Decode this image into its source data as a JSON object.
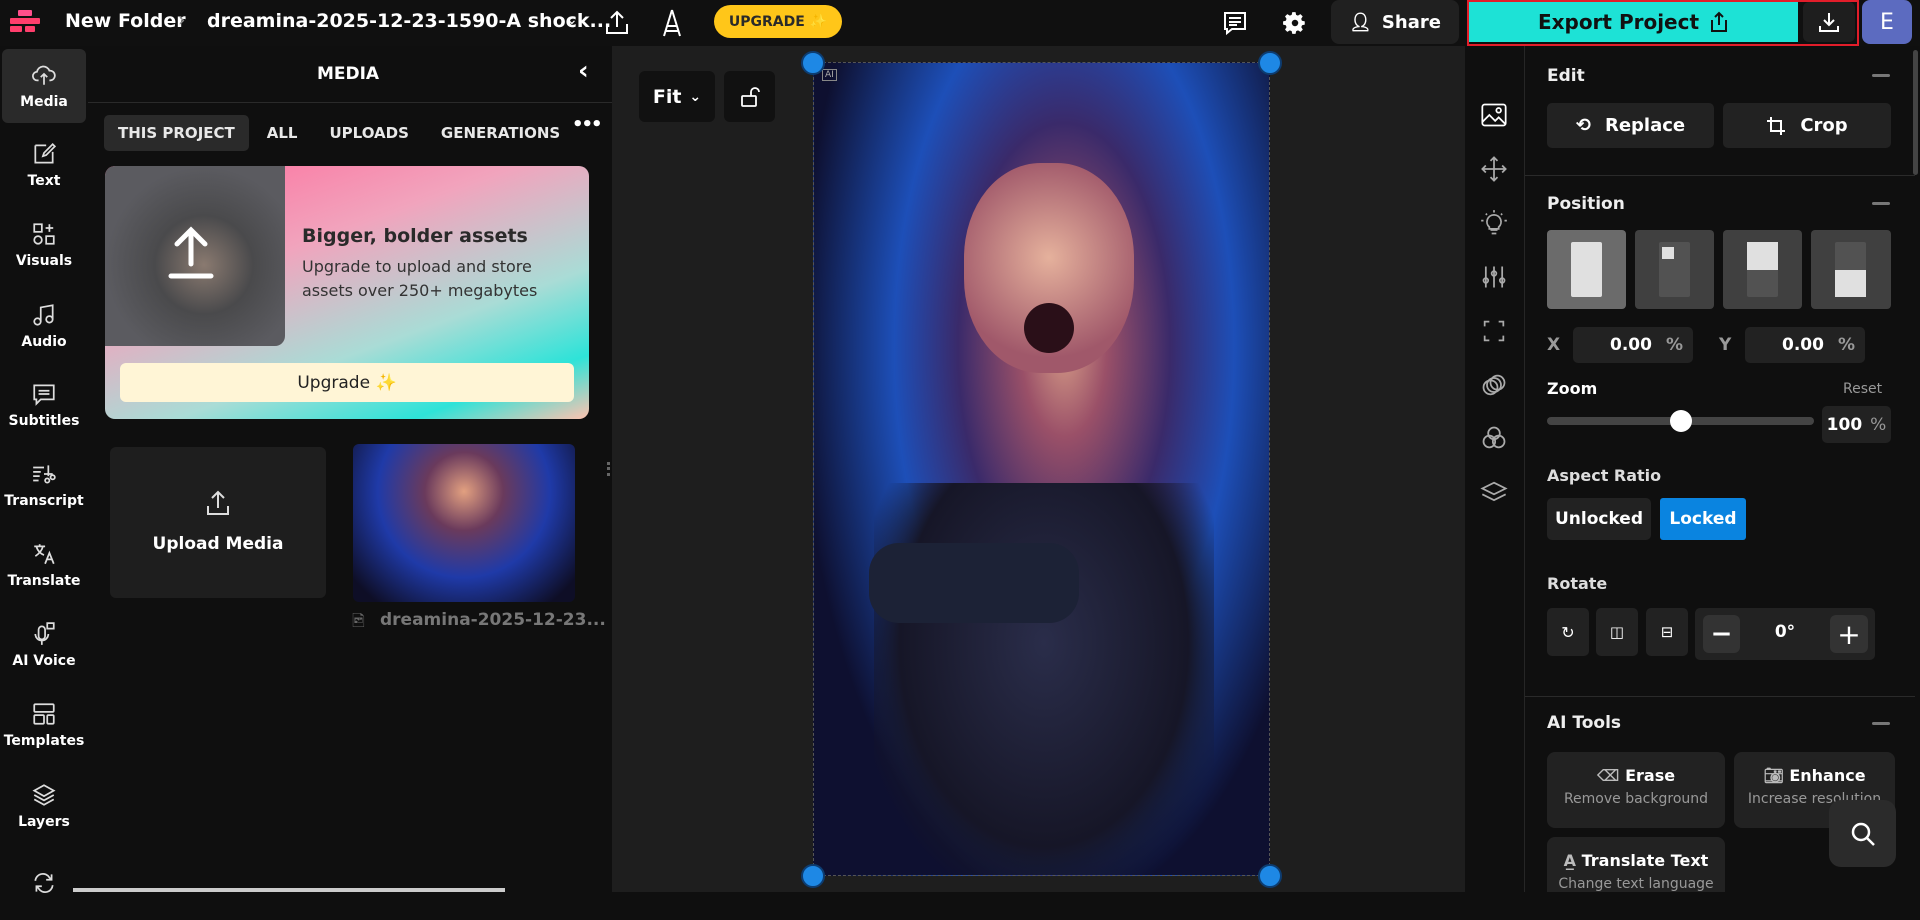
{
  "topbar": {
    "folder": "New Folder",
    "filename": "dreamina-2025-12-23-1590-A shock...",
    "upgrade": "UPGRADE ✨",
    "share": "Share",
    "export": "Export Project",
    "avatar": "E"
  },
  "rail": [
    {
      "label": "Media"
    },
    {
      "label": "Text"
    },
    {
      "label": "Visuals"
    },
    {
      "label": "Audio"
    },
    {
      "label": "Subtitles"
    },
    {
      "label": "Transcript"
    },
    {
      "label": "Translate"
    },
    {
      "label": "AI Voice"
    },
    {
      "label": "Templates"
    },
    {
      "label": "Layers"
    }
  ],
  "media": {
    "title": "MEDIA",
    "tabs": [
      "THIS PROJECT",
      "ALL",
      "UPLOADS",
      "GENERATIONS"
    ],
    "promo": {
      "title": "Bigger, bolder assets",
      "body": "Upgrade to upload and store assets over 250+ megabytes",
      "button": "Upgrade ✨"
    },
    "upload": "Upload Media",
    "file": "dreamina-2025-12-23..."
  },
  "canvas": {
    "fit": "Fit",
    "badge": "AI"
  },
  "props": {
    "edit": {
      "title": "Edit",
      "replace": "Replace",
      "crop": "Crop"
    },
    "position": {
      "title": "Position",
      "x_label": "X",
      "x": "0.00",
      "y_label": "Y",
      "y": "0.00",
      "unit": "%"
    },
    "zoom": {
      "title": "Zoom",
      "reset": "Reset",
      "value": "100",
      "unit": "%",
      "fraction": 0.5
    },
    "aspect": {
      "title": "Aspect Ratio",
      "unlocked": "Unlocked",
      "locked": "Locked"
    },
    "rotate": {
      "title": "Rotate",
      "value": "0°"
    },
    "ai": {
      "title": "AI Tools",
      "erase": "Erase",
      "erase_sub": "Remove background",
      "enhance": "Enhance",
      "enhance_sub": "Increase resolution",
      "translate": "Translate Text",
      "translate_sub": "Change text language"
    }
  },
  "colors": {
    "export": "#1de2d6",
    "locked": "#0a84e0",
    "upgrade": "#ffc619",
    "avatar": "#5c6bc0",
    "handle": "#1e88e5"
  }
}
